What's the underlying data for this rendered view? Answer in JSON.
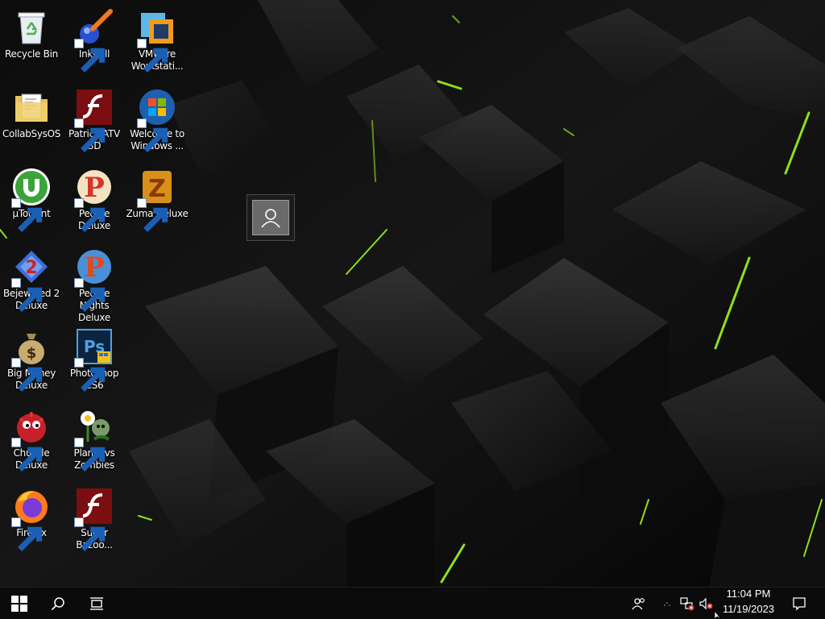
{
  "desktop": {
    "icons": [
      {
        "label": "Recycle Bin"
      },
      {
        "label": "InkBall"
      },
      {
        "label": "VMware Workstati..."
      },
      {
        "label": "CollabSysOS"
      },
      {
        "label": "Patrick ATV 3D"
      },
      {
        "label": "Welcome to Windows ..."
      },
      {
        "label": "µTorrent"
      },
      {
        "label": "Peggle Deluxe"
      },
      {
        "label": "Zuma Deluxe"
      },
      {
        "label": "Bejeweled 2 Deluxe"
      },
      {
        "label": "Peggle Nights Deluxe"
      },
      {
        "label": "Big Money Deluxe"
      },
      {
        "label": "Photoshop CS6"
      },
      {
        "label": "Chuzzle Deluxe"
      },
      {
        "label": "Plants vs Zombies"
      },
      {
        "label": "Firefox"
      },
      {
        "label": "Super Bazoo..."
      }
    ]
  },
  "taskbar": {
    "clock_time": "11:04 PM",
    "clock_date": "11/19/2023"
  },
  "colors": {
    "accent_green": "#8fe01a",
    "taskbar_bg": "#0b0b0b"
  }
}
